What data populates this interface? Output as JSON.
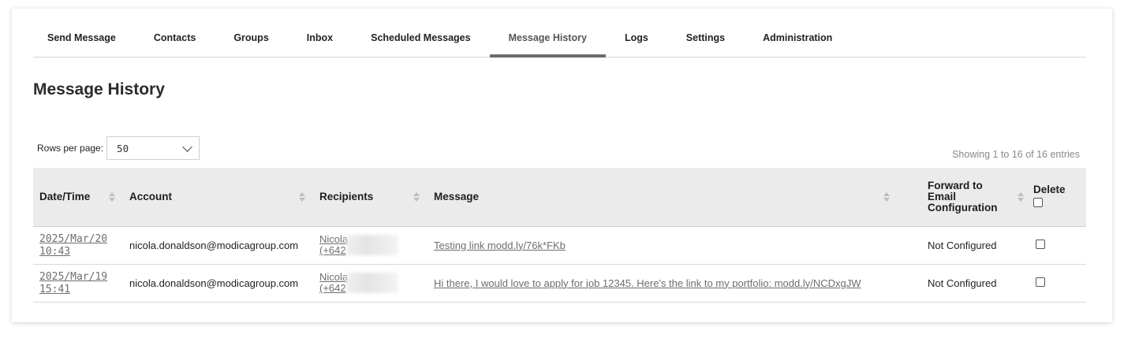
{
  "tabs": [
    {
      "label": "Send Message",
      "active": false
    },
    {
      "label": "Contacts",
      "active": false
    },
    {
      "label": "Groups",
      "active": false
    },
    {
      "label": "Inbox",
      "active": false
    },
    {
      "label": "Scheduled Messages",
      "active": false
    },
    {
      "label": "Message History",
      "active": true
    },
    {
      "label": "Logs",
      "active": false
    },
    {
      "label": "Settings",
      "active": false
    },
    {
      "label": "Administration",
      "active": false
    }
  ],
  "page_title": "Message History",
  "rows_per_page": {
    "label": "Rows per page:",
    "value": "50"
  },
  "showing": "Showing 1 to 16 of 16 entries",
  "table": {
    "headers": {
      "datetime": "Date/Time",
      "account": "Account",
      "recipients": "Recipients",
      "message": "Message",
      "forward_1": "Forward to",
      "forward_2": "Email",
      "forward_3": "Configuration",
      "delete": "Delete"
    },
    "rows": [
      {
        "date": "2025/Mar/20",
        "time": "10:43",
        "account": "nicola.donaldson@modicagroup.com",
        "recipient_name": "Nicola",
        "recipient_num": "(+642",
        "message": "Testing link modd.ly/76k*FKb",
        "forward": "Not Configured"
      },
      {
        "date": "2025/Mar/19",
        "time": "15:41",
        "account": "nicola.donaldson@modicagroup.com",
        "recipient_name": "Nicola",
        "recipient_num": "(+642",
        "message": "Hi there, I would love to apply for job 12345. Here's the link to my portfolio: modd.ly/NCDxgJW",
        "forward": "Not Configured"
      }
    ]
  }
}
